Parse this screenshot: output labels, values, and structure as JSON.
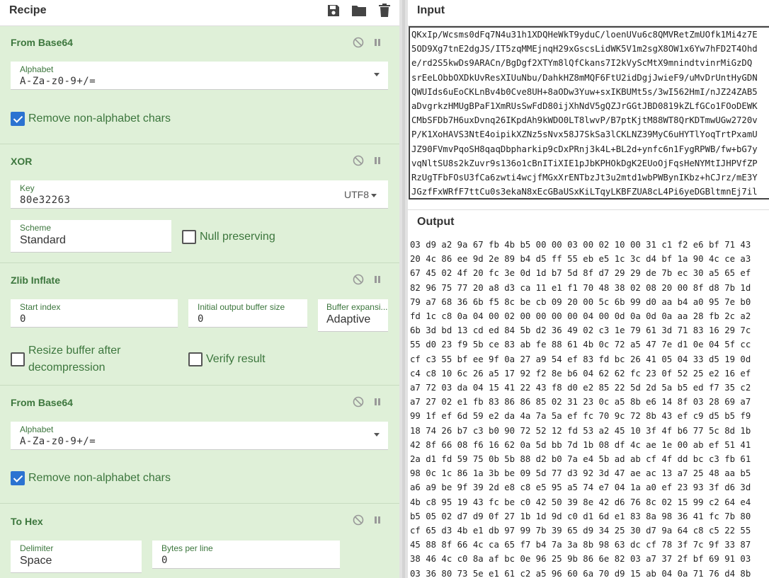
{
  "recipe": {
    "title": "Recipe"
  },
  "ops": {
    "from_base64_1": {
      "title": "From Base64",
      "alphabet_label": "Alphabet",
      "alphabet_value": "A-Za-z0-9+/=",
      "remove_label": "Remove non-alphabet chars",
      "remove_checked": true
    },
    "xor": {
      "title": "XOR",
      "key_label": "Key",
      "key_value": "80e32263",
      "encoding": "UTF8",
      "scheme_label": "Scheme",
      "scheme_value": "Standard",
      "null_label": "Null preserving",
      "null_checked": false
    },
    "zlib": {
      "title": "Zlib Inflate",
      "start_label": "Start index",
      "start_value": "0",
      "buffer_label": "Initial output buffer size",
      "buffer_value": "0",
      "expansion_label": "Buffer expansi...",
      "expansion_value": "Adaptive",
      "resize_label_1": "Resize buffer after",
      "resize_label_2": "decompression",
      "verify_label": "Verify result"
    },
    "from_base64_2": {
      "title": "From Base64",
      "alphabet_label": "Alphabet",
      "alphabet_value": "A-Za-z0-9+/=",
      "remove_label": "Remove non-alphabet chars",
      "remove_checked": true
    },
    "to_hex": {
      "title": "To Hex",
      "delim_label": "Delimiter",
      "delim_value": "Space",
      "bpl_label": "Bytes per line",
      "bpl_value": "0"
    }
  },
  "input": {
    "title": "Input",
    "lines": [
      "QKxIp/Wcsms0dFq7N4u31h1XDQHeWkT9yduC/loenUVu6c8QMVRetZmUOfk1Mi4z7E",
      "5OD9Xg7tnE2dgJS/IT5zqMMEjnqH29xGscsLidWK5V1m2sgX8OW1x6Yw7hFD2T4Ohd",
      "e/rd2S5kwDs9ARACn/BgDgf2XTYm8lQfCkans7I2kVyScMtX9mnindtvinrMiGzDQ",
      "srEeLObbOXDkUvResXIUuNbu/DahkHZ8mMQF6FtU2idDgjJwieF9/uMvDrUntHyGDN",
      "QWUIds6uEoCKLnBv4b0Cve8UH+8aODw3Yuw+sxIKBUMt5s/3wI562HmI/nJZ24ZAB5",
      "aDvgrkzHMUgBPaF1XmRUsSwFdD80ijXhNdV5gQZJrGGtJBD0819kZLfGCo1FOoDEWK",
      "CMbSFDb7H6uxDvnq26IKpdAh9kWDO0LT8lwvP/B7ptKjtM88WT8QrKDTmwUGw2720v",
      "P/K1XoHAVS3NtE4oipikXZNz5sNvx58J7SkSa3lCKLNZ39MyC6uHYTlYoqTrtPxamU",
      "JZ90FVmvPqoSH8qaqDbpharkip9cDxPRnj3k4L+BL2d+ynfc6n1FygRPWB/fw+bG7y",
      "vqNltSU8s2kZuvr9s136o1cBnITiXIE1pJbKPHOkDgK2EUoOjFqsHeNYMtIJHPVfZP",
      "RzUgTFbFOsU3fCa6zwti4wcjfMGxXrENTbzJt3u2mtd1wbPWBynIKbz+hCJrz/mE3Y",
      "JGzfFxWRfF7ttCu0s3ekaN8xEcGBaUSxKiLTqyLKBFZUA8cL4Pi6yeDGBltmnEj7il"
    ]
  },
  "output": {
    "title": "Output",
    "lines": [
      "03 d9 a2 9a 67 fb 4b b5 00 00 03 00 02 10 00 31 c1 f2 e6 bf 71 43",
      "20 4c 86 ee 9d 2e 89 b4 d5 ff 55 eb e5 1c 3c d4 bf 1a 90 4c ce a3",
      "67 45 02 4f 20 fc 3e 0d 1d b7 5d 8f d7 29 29 de 7b ec 30 a5 65 ef",
      "82 96 75 77 20 a8 d3 ca 11 e1 f1 70 48 38 02 08 20 00 8f d8 7b 1d",
      "79 a7 68 36 6b f5 8c be cb 09 20 00 5c 6b 99 d0 aa b4 a0 95 7e b0",
      "fd 1c c8 0a 04 00 02 00 00 00 00 04 00 0d 0a 0d 0a aa 28 fb 2c a2",
      "6b 3d bd 13 cd ed 84 5b d2 36 49 02 c3 1e 79 61 3d 71 83 16 29 7c",
      "55 d0 23 f9 5b ce 83 ab fe 88 61 4b 0c 72 a5 47 7e d1 0e 04 5f cc",
      "cf c3 55 bf ee 9f 0a 27 a9 54 ef 83 fd bc 26 41 05 04 33 d5 19 0d",
      "c4 c8 10 6c 26 a5 17 92 f2 8e b6 04 62 62 fc 23 0f 52 25 e2 16 ef",
      "a7 72 03 da 04 15 41 22 43 f8 d0 e2 85 22 5d 2d 5a b5 ed f7 35 c2",
      "a7 27 02 e1 fb 83 86 86 85 02 31 23 0c a5 8b e6 14 8f 03 28 69 a7",
      "99 1f ef 6d 59 e2 da 4a 7a 5a ef fc 70 9c 72 8b 43 ef c9 d5 b5 f9",
      "18 74 26 b7 c3 b0 90 72 52 12 fd 53 a2 45 10 3f 4f b6 77 5c 8d 1b",
      "42 8f 66 08 f6 16 62 0a 5d bb 7d 1b 08 df 4c ae 1e 00 ab ef 51 41",
      "2a d1 fd 59 75 0b 5b 88 d2 b0 7a e4 5b ad ab cf 4f dd bc c3 fb 61",
      "98 0c 1c 86 1a 3b be 09 5d 77 d3 92 3d 47 ae ac 13 a7 25 48 aa b5",
      "a6 a9 be 9f 39 2d e8 c8 e5 95 a5 74 e7 04 1a a0 ef 23 93 3f d6 3d",
      "4b c8 95 19 43 fc be c0 42 50 39 8e 42 d6 76 8c 02 15 99 c2 64 e4",
      "b5 05 02 d7 d9 0f 27 1b 1d 9d c0 d1 6d e1 83 8a 98 36 41 fc 7b 80",
      "cf 65 d3 4b e1 db 97 99 7b 39 65 d9 34 25 30 d7 9a 64 c8 c5 22 55",
      "45 88 8f 66 4c ca 65 f7 b4 7a 3a 8b 98 63 dc cf 78 3f 7c 9f 33 87",
      "38 46 4c c0 8a af bc 0e 96 25 9b 86 6e 82 03 a7 37 2f bf 69 91 03",
      "03 36 80 73 5e e1 61 c2 a5 96 60 6a 70 d9 15 ab 04 0a 71 76 d4 8b"
    ]
  }
}
